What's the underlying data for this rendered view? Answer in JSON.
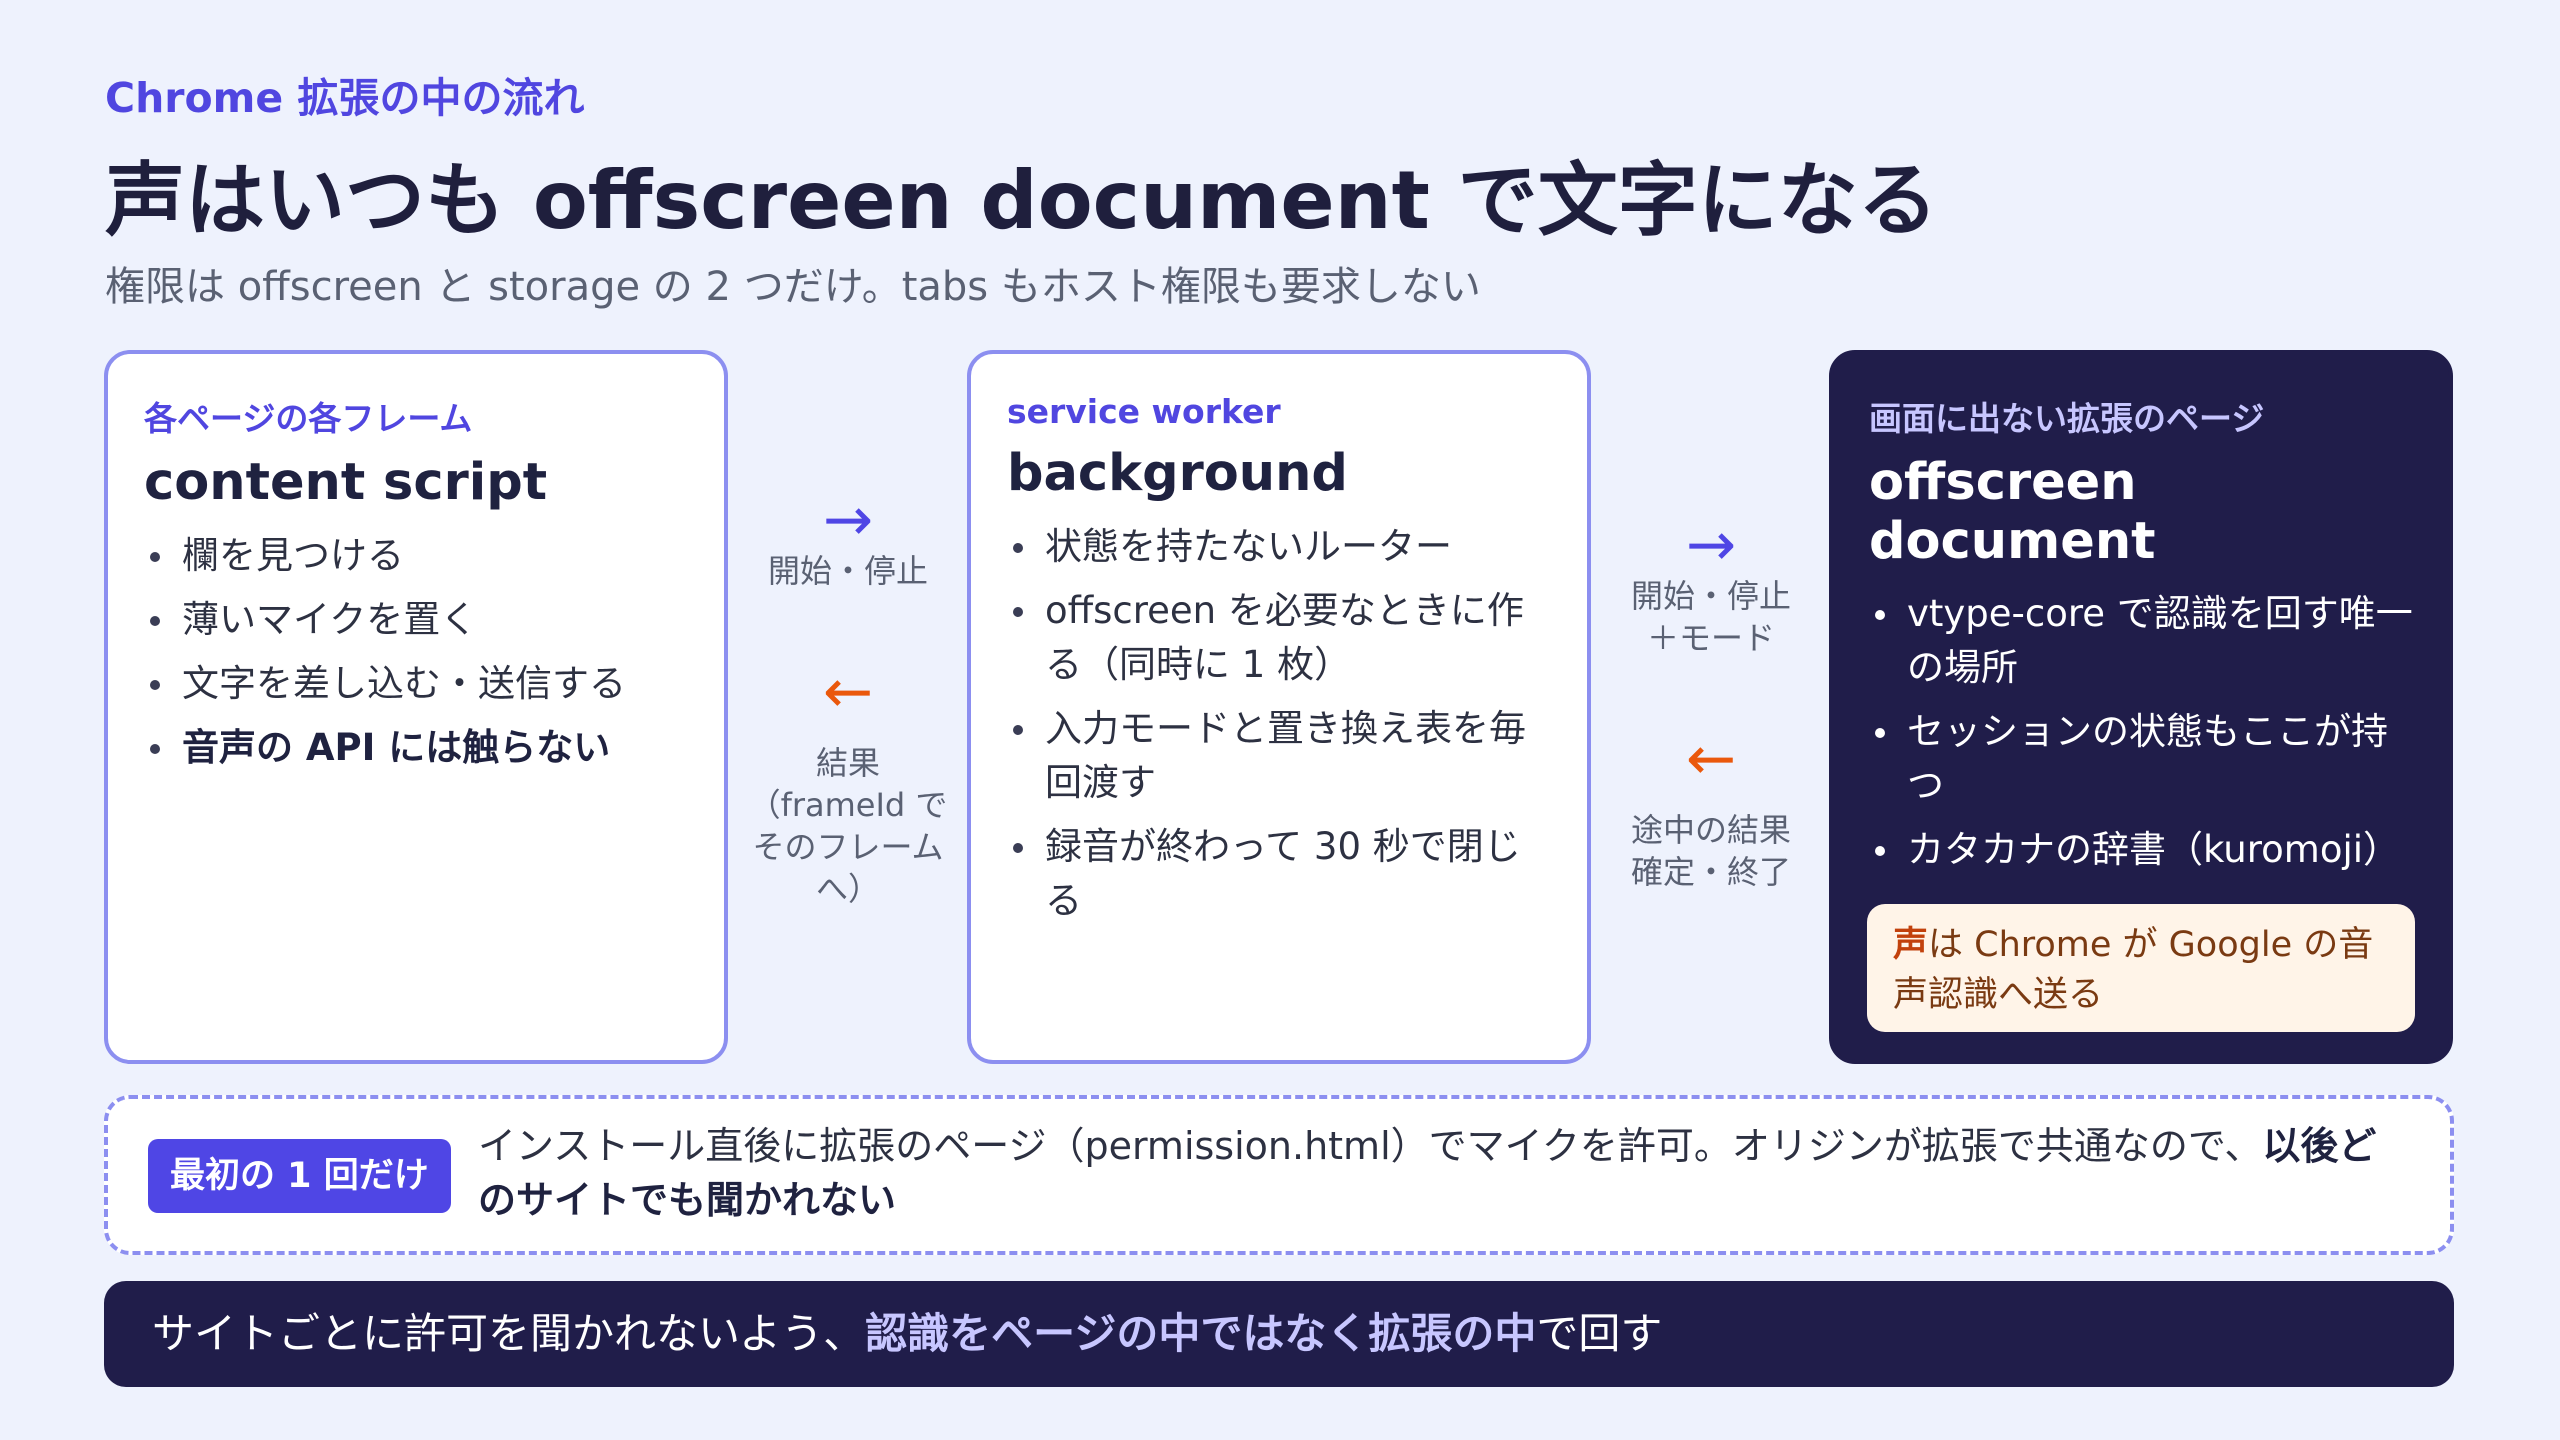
{
  "header": {
    "eyebrow": "Chrome 拡張の中の流れ",
    "title": "声はいつも offscreen document で文字になる",
    "subtitle": "権限は offscreen と storage の 2 つだけ。tabs もホスト権限も要求しない"
  },
  "cards": [
    {
      "eyebrow": "各ページの各フレーム",
      "title": "content script",
      "items": [
        "欄を見つける",
        "薄いマイクを置く",
        "文字を差し込む・送信する"
      ],
      "strong_item": "音声の API には触らない"
    },
    {
      "eyebrow": "service worker",
      "title": "background",
      "items": [
        "状態を持たないルーター",
        "offscreen を必要なときに作る（同時に 1 枚）",
        "入力モードと置き換え表を毎回渡す",
        "録音が終わって 30 秒で閉じる"
      ]
    },
    {
      "eyebrow": "画面に出ない拡張のページ",
      "title": "offscreen document",
      "items": [
        "vtype-core で認識を回す唯一の場所",
        "セッションの状態もここが持つ",
        "カタカナの辞書（kuromoji）"
      ],
      "note": {
        "highlight": "声",
        "text": "は Chrome が Google の音声認識へ送る"
      }
    }
  ],
  "connectors": [
    {
      "forward": {
        "arrow": "→",
        "label": "開始・停止"
      },
      "back": {
        "arrow": "←",
        "label": "結果\n（frameId で\nそのフレーム\nへ）"
      }
    },
    {
      "forward": {
        "arrow": "→",
        "label": "開始・停止\n＋モード"
      },
      "back": {
        "arrow": "←",
        "label": "途中の結果\n確定・終了"
      }
    }
  ],
  "banner": {
    "badge": "最初の 1 回だけ",
    "text": "インストール直後に拡張のページ（permission.html）でマイクを許可。オリジンが拡張で共通なので、",
    "bold": "以後どのサイトでも聞かれない"
  },
  "footer": {
    "text_before": "サイトごとに許可を聞かれないよう、",
    "bold": "認識をページの中ではなく拡張の中",
    "text_after": "で回す"
  },
  "colors": {
    "accent": "#4f46e5",
    "dark": "#201d4a",
    "orange": "#ea580c",
    "background": "#eef2fd"
  }
}
